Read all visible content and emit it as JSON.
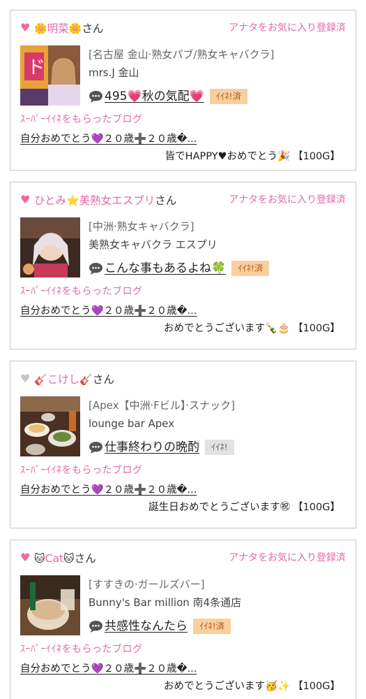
{
  "cards": [
    {
      "name_left_emoji": "🌼",
      "name": "明菜",
      "name_right_emoji": "🌼",
      "san": "さん",
      "favorite_status": "アナタをお気に入り登録済",
      "shop_area": "[名古屋 金山·熟女パブ/熟女キャバクラ]",
      "shop_name": "mrs.J 金山",
      "blog_title": "495💗秋の気配💗",
      "iine_label": "ｲｲﾈ!済",
      "super_label": "ｽｰﾊﾟｰｲｲﾈをもらったブログ",
      "sub_blog": "自分おめでとう💜２０歳➕２０歳�...",
      "gift_message": "皆でHAPPY♥おめでとう🎉",
      "gift_points": "【100G】"
    },
    {
      "name_left_emoji": "",
      "name": "ひとみ",
      "name_right_emoji": "⭐",
      "name_suffix": "美熟女エスプリ",
      "san": "さん",
      "favorite_status": "アナタをお気に入り登録済",
      "shop_area": "[中洲·熟女キャバクラ]",
      "shop_name": "美熟女キャバクラ エスプリ",
      "blog_title": "こんな事もあるよね🍀",
      "iine_label": "ｲｲﾈ!済",
      "super_label": "ｽｰﾊﾟｰｲｲﾈをもらったブログ",
      "sub_blog": "自分おめでとう💜２０歳➕２０歳�...",
      "gift_message": "おめでとうございます🍾🎂",
      "gift_points": "【100G】"
    },
    {
      "name_left_emoji": "🎸",
      "name": "こけし",
      "name_right_emoji": "🎸",
      "san": "さん",
      "favorite_status": "",
      "shop_area": "[Apex【中洲·Fビル】·スナック]",
      "shop_name": "lounge bar Apex",
      "blog_title": "仕事終わりの晩酌",
      "iine_label": "ｲｲﾈ!",
      "super_label": "ｽｰﾊﾟｰｲｲﾈをもらったブログ",
      "sub_blog": "自分おめでとう💜２０歳➕２０歳�...",
      "gift_message": "誕生日おめでとうございます㊗",
      "gift_points": "【100G】"
    },
    {
      "name_left_emoji": "🐱",
      "name": "Cat",
      "name_right_emoji": "🐱",
      "san": "さん",
      "favorite_status": "アナタをお気に入り登録済",
      "shop_area": "[すすきの·ガールズバー]",
      "shop_name": "Bunny's Bar million 南4条通店",
      "blog_title": "共感性なんたら",
      "iine_label": "ｲｲﾈ!済",
      "super_label": "ｽｰﾊﾟｰｲｲﾈをもらったブログ",
      "sub_blog": "自分おめでとう💜２０歳➕２０歳�...",
      "gift_message": "おめでとうございます🥳✨",
      "gift_points": "【100G】"
    }
  ],
  "icons": {
    "heart_active": "♥",
    "heart_inactive": "♥",
    "comment": "speech-bubble-icon"
  },
  "colors": {
    "pink": "#e06aa8",
    "heart_pink": "#ee6a96",
    "badge_orange": "#f8cf9e",
    "badge_gray": "#e2e2e2",
    "border": "#c8c8c8"
  }
}
